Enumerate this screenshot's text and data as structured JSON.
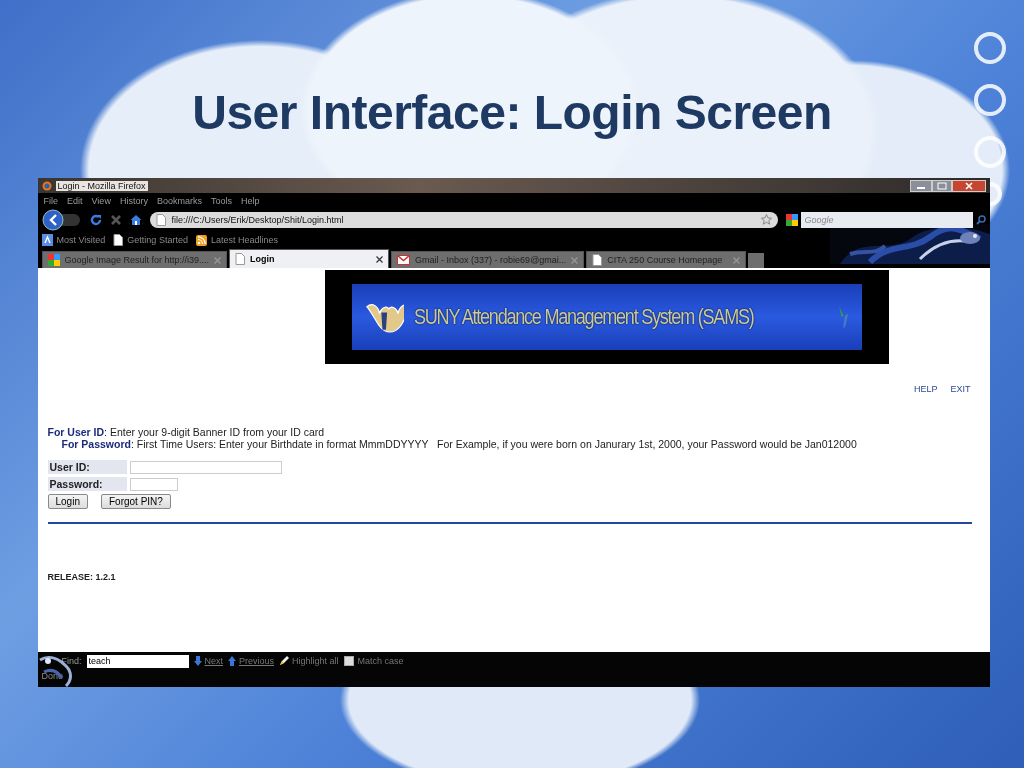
{
  "slide": {
    "title": "User Interface: Login Screen"
  },
  "browser": {
    "title": "Login - Mozilla Firefox",
    "menu": [
      "File",
      "Edit",
      "View",
      "History",
      "Bookmarks",
      "Tools",
      "Help"
    ],
    "address": "file:///C:/Users/Erik/Desktop/Shit/Login.html",
    "search_placeholder": "Google",
    "bookmarks": [
      {
        "label": "Most Visited",
        "kind": "visited"
      },
      {
        "label": "Getting Started",
        "kind": "page"
      },
      {
        "label": "Latest Headlines",
        "kind": "feed"
      }
    ],
    "tabs": [
      {
        "label": "Google Image Result for http://i39....",
        "kind": "google",
        "selected": false
      },
      {
        "label": "Login",
        "kind": "page",
        "selected": true
      },
      {
        "label": "Gmail - Inbox (337) - robie69@gmai...",
        "kind": "mail",
        "selected": false
      },
      {
        "label": "CITA 250 Course Homepage",
        "kind": "page",
        "selected": false
      }
    ],
    "status": "Done"
  },
  "page": {
    "banner": "SUNY Attendance Management System (SAMS)",
    "links": [
      "HELP",
      "EXIT"
    ],
    "instructions": [
      "**For User ID**: Enter your 9-digit Banner ID from your ID card",
      "**For Password**: First Time Users: Enter your Birthdate in format MmmDDYYYY   For Example, if you were born on Janurary 1st, 2000, your Password would be Jan012000"
    ],
    "fields": [
      {
        "label": "User ID:",
        "kind": "long"
      },
      {
        "label": "Password:",
        "kind": "short"
      }
    ],
    "buttons": [
      "Login",
      "Forgot PIN?"
    ],
    "release": "RELEASE: 1.2.1"
  },
  "find_bar": {
    "label": "Find:",
    "value": "teach",
    "next": "Next",
    "previous": "Previous",
    "highlight": "Highlight all",
    "match_case": {
      "label": "Match case",
      "checked": false
    }
  }
}
